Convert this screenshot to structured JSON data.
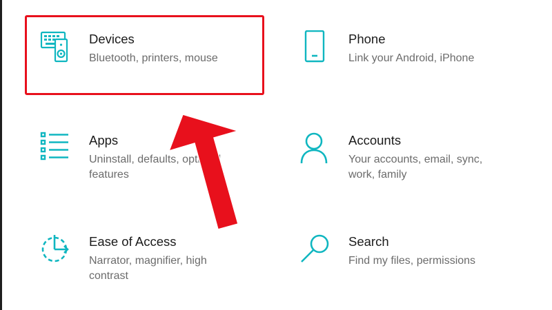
{
  "settings_tiles": [
    {
      "title": "Devices",
      "description": "Bluetooth, printers, mouse",
      "icon": "devices-icon"
    },
    {
      "title": "Phone",
      "description": "Link your Android, iPhone",
      "icon": "phone-icon"
    },
    {
      "title": "Apps",
      "description": "Uninstall, defaults, optional features",
      "icon": "apps-list-icon"
    },
    {
      "title": "Accounts",
      "description": "Your accounts, email, sync, work, family",
      "icon": "person-icon"
    },
    {
      "title": "Ease of Access",
      "description": "Narrator, magnifier, high contrast",
      "icon": "ease-of-access-icon"
    },
    {
      "title": "Search",
      "description": "Find my files, permissions",
      "icon": "search-icon"
    }
  ],
  "colors": {
    "accent": "#0fb6c0",
    "title_text": "#1b1b1b",
    "description_text": "#6b6b6b",
    "highlight": "#e8101c"
  },
  "annotation": {
    "highlighted_tile": "Devices",
    "arrow_direction": "up-left"
  }
}
